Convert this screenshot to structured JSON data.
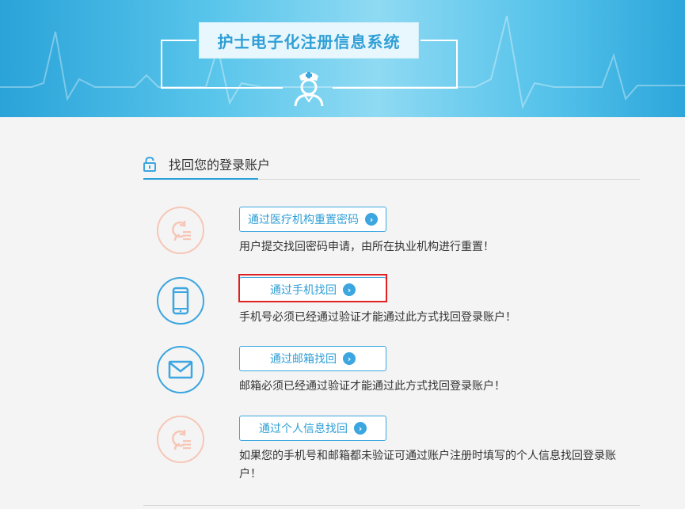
{
  "header": {
    "system_title": "护士电子化注册信息系统"
  },
  "section": {
    "title": "找回您的登录账户"
  },
  "options": [
    {
      "button_label": "通过医疗机构重置密码",
      "description": "用户提交找回密码申请，由所在执业机构进行重置！",
      "icon": "person-refresh-icon"
    },
    {
      "button_label": "通过手机找回",
      "description": "手机号必须已经通过验证才能通过此方式找回登录账户！",
      "icon": "mobile-phone-icon",
      "highlighted": true
    },
    {
      "button_label": "通过邮箱找回",
      "description": "邮箱必须已经通过验证才能通过此方式找回登录账户！",
      "icon": "envelope-icon"
    },
    {
      "button_label": "通过个人信息找回",
      "description": "如果您的手机号和邮箱都未验证可通过账户注册时填写的个人信息找回登录账户！",
      "icon": "person-refresh-icon"
    }
  ],
  "colors": {
    "accent": "#3ba6e0",
    "highlight_border": "#e02020",
    "pink_icon": "#f6c7b7"
  }
}
